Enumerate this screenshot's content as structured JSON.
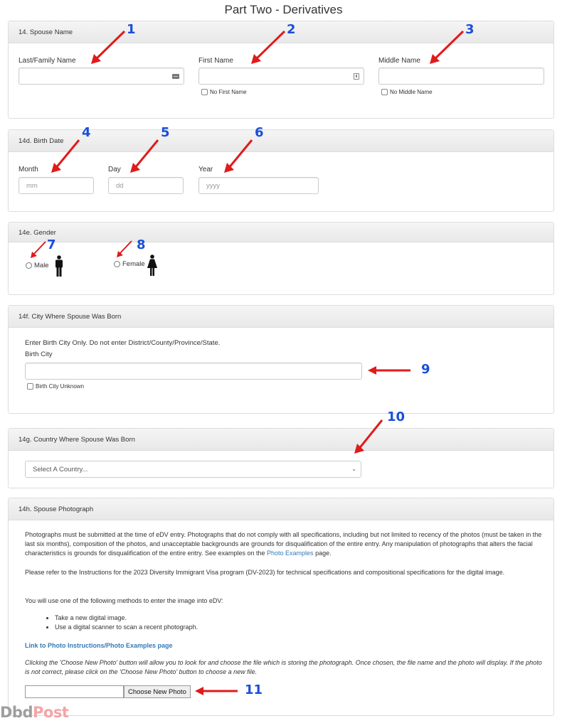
{
  "page": {
    "title": "Part Two - Derivatives"
  },
  "spouse_name": {
    "heading": "14. Spouse Name",
    "last_name": {
      "label": "Last/Family Name",
      "value": "",
      "icon": "keyboard-icon"
    },
    "first_name": {
      "label": "First Name",
      "value": "",
      "icon": "id-card-icon",
      "checkbox_label": "No First Name",
      "checked": false
    },
    "middle_name": {
      "label": "Middle Name",
      "value": "",
      "checkbox_label": "No Middle Name",
      "checked": false
    }
  },
  "birth_date": {
    "heading": "14d. Birth Date",
    "month": {
      "label": "Month",
      "placeholder": "mm",
      "value": ""
    },
    "day": {
      "label": "Day",
      "placeholder": "dd",
      "value": ""
    },
    "year": {
      "label": "Year",
      "placeholder": "yyyy",
      "value": ""
    }
  },
  "gender": {
    "heading": "14e. Gender",
    "options": [
      {
        "label": "Male",
        "icon": "male-figure-icon",
        "selected": false
      },
      {
        "label": "Female",
        "icon": "female-figure-icon",
        "selected": false
      }
    ]
  },
  "birth_city": {
    "heading": "14f. City Where Spouse Was Born",
    "instruction": "Enter Birth City Only. Do not enter District/County/Province/State.",
    "label": "Birth City",
    "value": "",
    "checkbox_label": "Birth City Unknown",
    "checked": false
  },
  "birth_country": {
    "heading": "14g. Country Where Spouse Was Born",
    "selected": "Select A Country..."
  },
  "photograph": {
    "heading": "14h. Spouse Photograph",
    "para1_text": "Photographs must be submitted at the time of eDV entry. Photographs that do not comply with all specifications, including but not limited to recency of the photos (must be taken in the last six months), composition of the photos, and unacceptable backgrounds are grounds for disqualification of the entire entry. Any manipulation of photographs that alters the facial characteristics is grounds for disqualification of the entire entry. See examples on the ",
    "para1_link": "Photo Examples",
    "para1_end": " page.",
    "para2": "Please refer to the Instructions for the 2023 Diversity Immigrant Visa program (DV-2023) for technical specifications and compositional specifications for the digital image.",
    "para3": "You will use one of the following methods to enter the image into eDV:",
    "methods": [
      "Take a new digital image.",
      "Use a digital scanner to scan a recent photograph."
    ],
    "instructions_link": "Link to Photo Instructions/Photo Examples page",
    "choose_note": "Clicking the 'Choose New Photo' button will allow you to look for and choose the file which is storing the photograph. Once chosen, the file name and the photo will display. If the photo is not correct, please click on the 'Choose New Photo' button to choose a new file.",
    "file_value": "",
    "choose_button": "Choose New Photo"
  },
  "annotations": [
    "1",
    "2",
    "3",
    "4",
    "5",
    "6",
    "7",
    "8",
    "9",
    "10",
    "11"
  ],
  "colors": {
    "annotation_number": "#1a4fd8",
    "annotation_arrow": "#e01b1b",
    "link": "#337ab7",
    "panel_border": "#dddddd"
  },
  "watermark": {
    "part1": "Dbd",
    "part2": "Post"
  }
}
